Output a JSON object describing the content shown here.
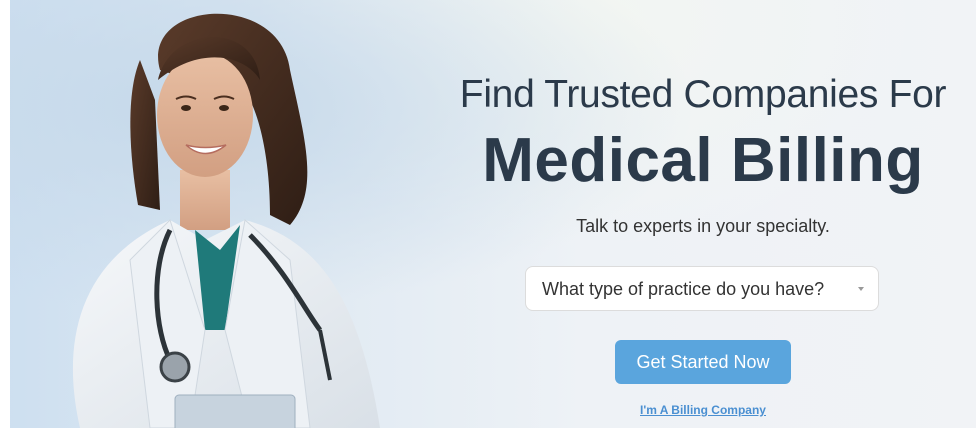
{
  "hero": {
    "headline_top": "Find Trusted Companies For",
    "headline_main": "Medical Billing",
    "subtitle": "Talk to experts in your specialty.",
    "practice_select": {
      "value": "What type of practice do you have?"
    },
    "cta_label": "Get Started Now",
    "billing_link": "I'm A Billing Company"
  },
  "colors": {
    "headline": "#2b3a4a",
    "cta_background": "#5aa5dd",
    "link": "#4a8fd1",
    "scrub_top": "#1f7a7a"
  },
  "image": {
    "subject": "smiling female doctor in white coat with stethoscope"
  }
}
